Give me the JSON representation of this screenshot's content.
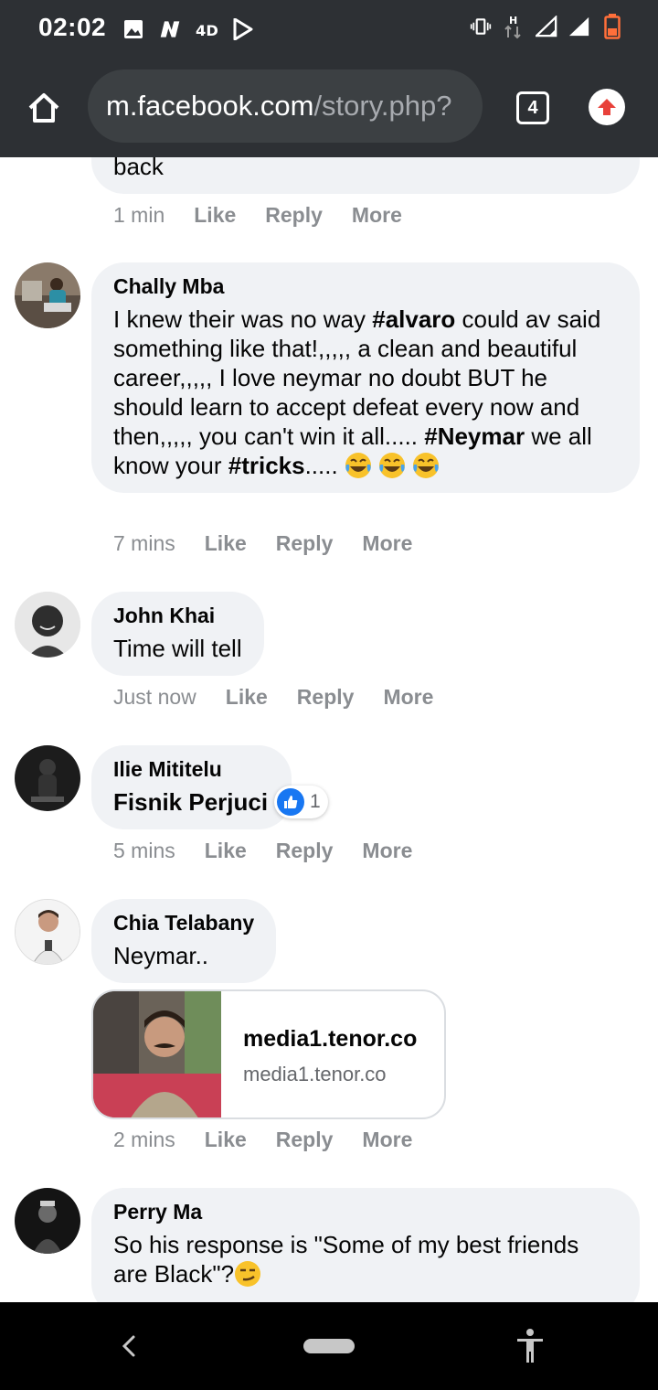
{
  "status_bar": {
    "time": "02:02",
    "left_icons": [
      "image-icon",
      "n-app-icon",
      "4d-icon",
      "play-store-icon"
    ],
    "right_icons": [
      "vibrate-icon",
      "data-h-icon",
      "signal-icon",
      "signal-icon",
      "battery-icon"
    ]
  },
  "browser": {
    "url_host": "m.facebook.com",
    "url_path": "/story.php?",
    "tab_count": "4"
  },
  "comments": [
    {
      "author": "",
      "text": "back",
      "time": "1 min",
      "like": "Like",
      "reply": "Reply",
      "more": "More"
    },
    {
      "author": "Chally Mba",
      "text_parts": [
        {
          "t": "I knew their was no way ",
          "b": false
        },
        {
          "t": "#alvaro",
          "b": true
        },
        {
          "t": " could av said something like that!,,,,, a clean and beautiful career,,,,, I love neymar no doubt BUT he should learn to accept defeat every now and then,,,,, you can't win it all..... ",
          "b": false
        },
        {
          "t": "#Neymar",
          "b": true
        },
        {
          "t": " we all know your ",
          "b": false
        },
        {
          "t": "#tricks",
          "b": true
        },
        {
          "t": "..... ",
          "b": false
        }
      ],
      "emojis": [
        "laughing-tears-emoji",
        "laughing-tears-emoji",
        "laughing-tears-emoji"
      ],
      "time": "7 mins",
      "like": "Like",
      "reply": "Reply",
      "more": "More"
    },
    {
      "author": "John Khai",
      "text": "Time will tell",
      "time": "Just now",
      "like": "Like",
      "reply": "Reply",
      "more": "More"
    },
    {
      "author": "Ilie Mititelu",
      "text": "Fisnik Perjuci",
      "reaction_count": "1",
      "reaction_type": "like",
      "time": "5 mins",
      "like": "Like",
      "reply": "Reply",
      "more": "More"
    },
    {
      "author": "Chia Telabany",
      "text": "Neymar..",
      "link": {
        "title": "media1.tenor.co",
        "domain": "media1.tenor.co"
      },
      "time": "2 mins",
      "like": "Like",
      "reply": "Reply",
      "more": "More"
    },
    {
      "author": "Perry Ma",
      "text": "So his response is \"Some of my best friends are Black\"?",
      "emoji": "smirk-emoji"
    }
  ],
  "colors": {
    "bubble": "#f0f2f5",
    "chrome_bar": "#2d3034",
    "url_field": "#3c4043",
    "meta_text": "#8a8d91",
    "like_blue": "#1877f2"
  }
}
